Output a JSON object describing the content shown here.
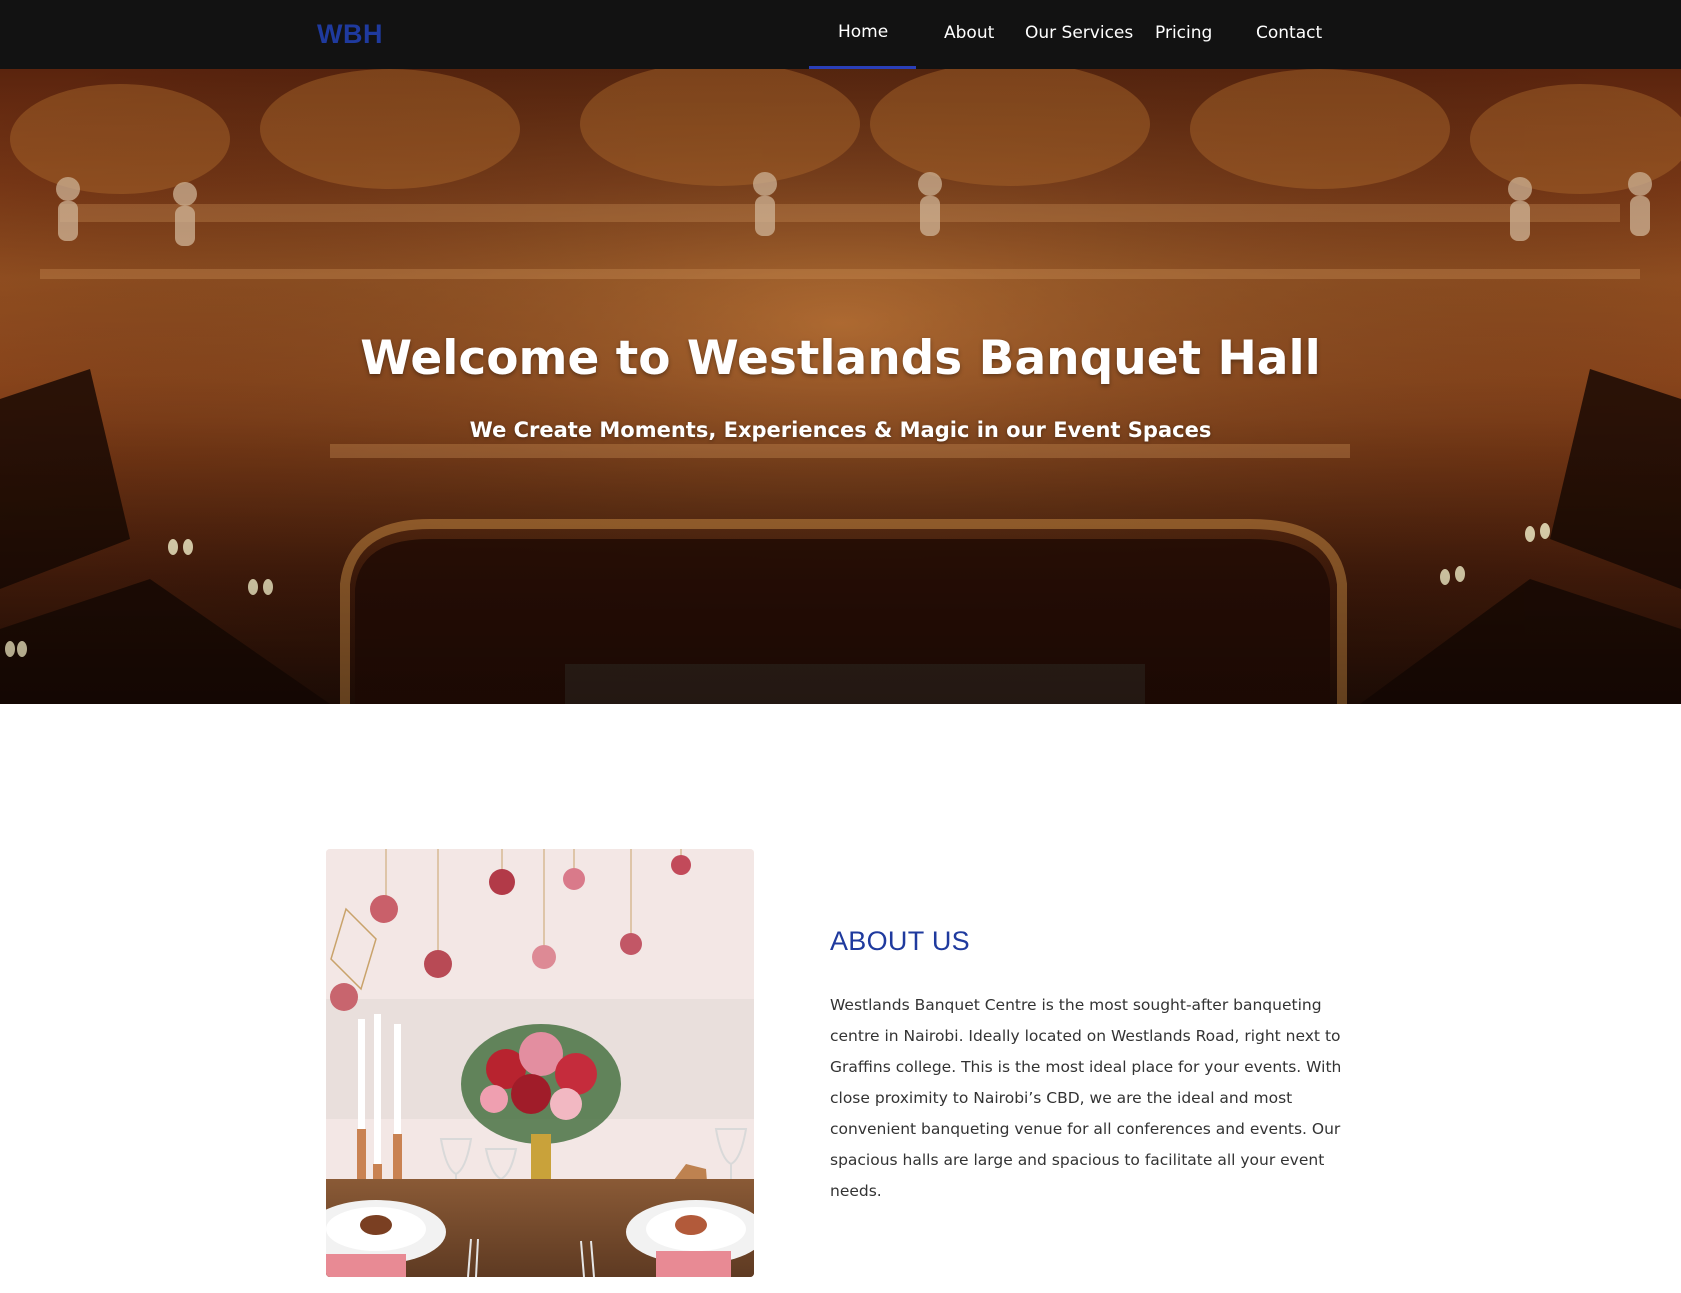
{
  "navbar": {
    "brand": "WBH",
    "items": [
      {
        "label": "Home",
        "active": true
      },
      {
        "label": "About"
      },
      {
        "label": "Our Services"
      },
      {
        "label": "Pricing"
      },
      {
        "label": "Contact"
      }
    ],
    "colors": {
      "background": "#121212",
      "brand": "#1f3a9e",
      "active_underline": "#2a3fb8"
    }
  },
  "hero": {
    "title": "Welcome to Westlands Banquet Hall",
    "subtitle": "We Create Moments, Experiences & Magic in our Event Spaces"
  },
  "about": {
    "heading": "ABOUT US",
    "body": "Westlands Banquet Centre is the most sought-after banqueting centre in Nairobi. Ideally located on Westlands Road, right next to Graffins college. This is the most ideal place for your events. With close proximity to Nairobi’s CBD, we are the ideal and most convenient banqueting venue for all conferences and events. Our spacious halls are large and spacious to facilitate all your event needs."
  }
}
